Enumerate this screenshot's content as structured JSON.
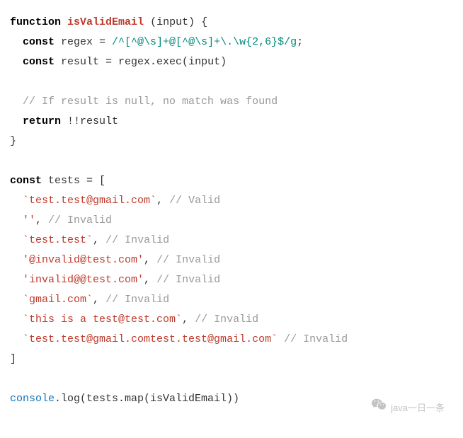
{
  "code": {
    "l1a": "function",
    "l1b": "isValidEmail",
    "l1c": " (input) {",
    "l2a": "  ",
    "l2b": "const",
    "l2c": " regex = ",
    "l2d": "/^[^@\\s]+@[^@\\s]+\\.\\w{2,6}$/g",
    "l2e": ";",
    "l3a": "  ",
    "l3b": "const",
    "l3c": " result = regex.exec(input)",
    "l4": " ",
    "l5a": "  ",
    "l5b": "// If result is null, no match was found",
    "l6a": "  ",
    "l6b": "return",
    "l6c": " !!result",
    "l7": "}",
    "l8": " ",
    "l9a": "const",
    "l9b": " tests = [",
    "l10a": "  ",
    "l10b": "`test.test@gmail.com`",
    "l10c": ", ",
    "l10d": "// Valid",
    "l11a": "  ",
    "l11b": "''",
    "l11c": ", ",
    "l11d": "// Invalid",
    "l12a": "  ",
    "l12b": "`test.test`",
    "l12c": ", ",
    "l12d": "// Invalid",
    "l13a": "  ",
    "l13b": "'@invalid@test.com'",
    "l13c": ", ",
    "l13d": "// Invalid",
    "l14a": "  ",
    "l14b": "'invalid@@test.com'",
    "l14c": ", ",
    "l14d": "// Invalid",
    "l15a": "  ",
    "l15b": "`gmail.com`",
    "l15c": ", ",
    "l15d": "// Invalid",
    "l16a": "  ",
    "l16b": "`this is a test@test.com`",
    "l16c": ", ",
    "l16d": "// Invalid",
    "l17a": "  ",
    "l17b": "`test.test@gmail.comtest.test@gmail.com`",
    "l17c": " ",
    "l17d": "// Invalid",
    "l18": "]",
    "l19": " ",
    "l20a": "console",
    "l20b": ".log(tests.map(isValidEmail))"
  },
  "watermark": "java一日一条"
}
